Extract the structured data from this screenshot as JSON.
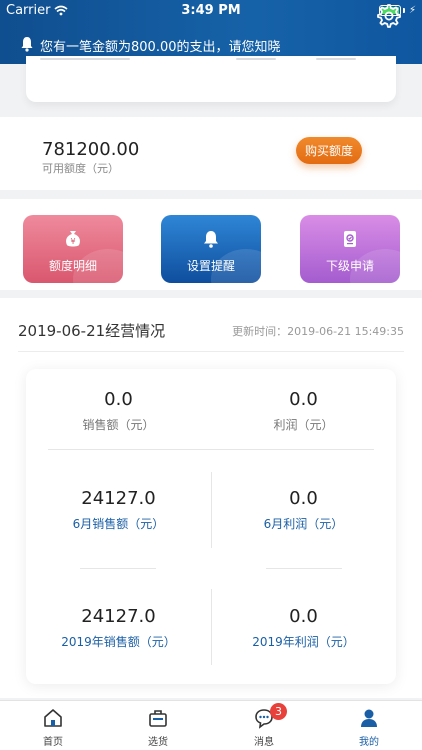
{
  "status_bar": {
    "carrier": "Carrier",
    "time": "3:49 PM"
  },
  "notice": {
    "text": "您有一笔金额为800.00的支出，请您知晓"
  },
  "quota": {
    "value": "781200.00",
    "label": "可用额度（元）",
    "buy_label": "购买额度"
  },
  "actions": [
    {
      "label": "额度明细",
      "icon": "money-bag-icon"
    },
    {
      "label": "设置提醒",
      "icon": "bell-icon"
    },
    {
      "label": "下级申请",
      "icon": "clipboard-check-icon"
    }
  ],
  "business": {
    "title": "2019-06-21经营情况",
    "update_time": "更新时间：2019-06-21 15:49:35",
    "stats": [
      {
        "value": "0.0",
        "label": "销售额（元）"
      },
      {
        "value": "0.0",
        "label": "利润（元）"
      },
      {
        "value": "24127.0",
        "label": "6月销售额（元）"
      },
      {
        "value": "0.0",
        "label": "6月利润（元）"
      },
      {
        "value": "24127.0",
        "label": "2019年销售额（元）"
      },
      {
        "value": "0.0",
        "label": "2019年利润（元）"
      }
    ]
  },
  "tabs": [
    {
      "label": "首页",
      "icon": "home-icon"
    },
    {
      "label": "选货",
      "icon": "shopping-bag-icon"
    },
    {
      "label": "消息",
      "icon": "chat-icon",
      "badge": "3"
    },
    {
      "label": "我的",
      "icon": "user-icon"
    }
  ],
  "colors": {
    "header": "#1662a8",
    "accent_orange": "#e36b12",
    "active_tab": "#1a5fa6",
    "badge": "#e8403a"
  }
}
